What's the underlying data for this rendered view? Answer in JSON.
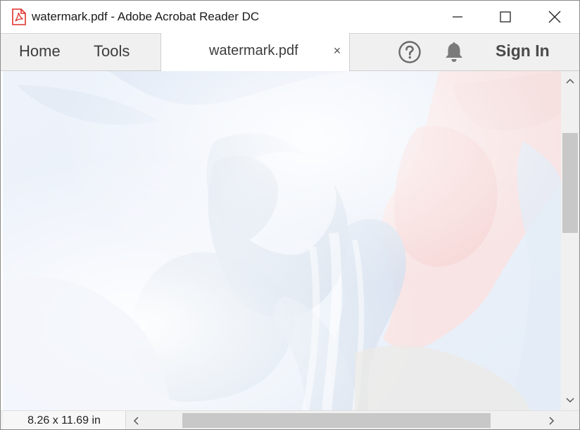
{
  "window": {
    "title": "watermark.pdf - Adobe Acrobat Reader DC",
    "app_icon": "acrobat-pdf-icon",
    "controls": {
      "minimize_icon": "minimize-icon",
      "maximize_icon": "maximize-icon",
      "close_icon": "close-icon"
    }
  },
  "toolbar": {
    "home_label": "Home",
    "tools_label": "Tools",
    "document_tab": {
      "label": "watermark.pdf",
      "close_glyph": "×"
    },
    "help_icon": "help-icon",
    "notifications_icon": "bell-icon",
    "sign_in_label": "Sign In"
  },
  "document": {
    "content": "watermark artwork (faded abstract)",
    "page_size": "8.26 x 11.69 in"
  },
  "colors": {
    "brand_red": "#e0312b",
    "toolbar_bg": "#f0f0f0",
    "scroll_thumb": "#c8c8c8"
  }
}
